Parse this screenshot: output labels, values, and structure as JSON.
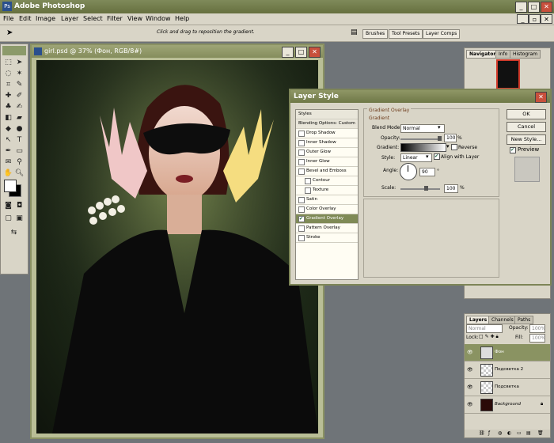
{
  "app": {
    "title": "Adobe Photoshop",
    "logo": "Ps"
  },
  "menu": [
    "File",
    "Edit",
    "Image",
    "Layer",
    "Select",
    "Filter",
    "View",
    "Window",
    "Help"
  ],
  "options_bar": {
    "hint": "Click and drag to reposition the gradient.",
    "tabs": [
      "Brushes",
      "Tool Presets",
      "Layer Comps"
    ]
  },
  "document": {
    "title": "girl.psd @ 37% (Фон, RGB/8#)"
  },
  "dialog": {
    "title": "Layer Style",
    "styles_header": "Styles",
    "items": [
      {
        "label": "Blending Options: Custom",
        "check": false,
        "hdr": true
      },
      {
        "label": "Drop Shadow",
        "check": false
      },
      {
        "label": "Inner Shadow",
        "check": false
      },
      {
        "label": "Outer Glow",
        "check": false
      },
      {
        "label": "Inner Glow",
        "check": false
      },
      {
        "label": "Bevel and Emboss",
        "check": false
      },
      {
        "label": "Contour",
        "check": false,
        "indent": true
      },
      {
        "label": "Texture",
        "check": false,
        "indent": true
      },
      {
        "label": "Satin",
        "check": false
      },
      {
        "label": "Color Overlay",
        "check": false
      },
      {
        "label": "Gradient Overlay",
        "check": true,
        "sel": true
      },
      {
        "label": "Pattern Overlay",
        "check": false
      },
      {
        "label": "Stroke",
        "check": false
      }
    ],
    "group_title": "Gradient Overlay",
    "sub_title": "Gradient",
    "blend_mode_label": "Blend Mode:",
    "blend_mode_value": "Normal",
    "opacity_label": "Opacity:",
    "opacity_value": "100",
    "opacity_unit": "%",
    "gradient_label": "Gradient:",
    "reverse_label": "Reverse",
    "style_label": "Style:",
    "style_value": "Linear",
    "align_label": "Align with Layer",
    "angle_label": "Angle:",
    "angle_value": "90",
    "angle_unit": "°",
    "scale_label": "Scale:",
    "scale_value": "100",
    "scale_unit": "%",
    "ok": "OK",
    "cancel": "Cancel",
    "new_style": "New Style...",
    "preview": "Preview"
  },
  "navigator": {
    "tabs": [
      "Navigator",
      "Info",
      "Histogram"
    ]
  },
  "layers": {
    "tabs": [
      "Layers",
      "Channels",
      "Paths"
    ],
    "blend": "Normal",
    "opacity_label": "Opacity:",
    "opacity_value": "100%",
    "lock_label": "Lock:",
    "fill_label": "Fill:",
    "fill_value": "100%",
    "rows": [
      {
        "name": "Фон",
        "active": true
      },
      {
        "name": "Подсветка 2",
        "active": false
      },
      {
        "name": "Подсветка",
        "active": false
      },
      {
        "name": "Background",
        "active": false
      }
    ]
  }
}
